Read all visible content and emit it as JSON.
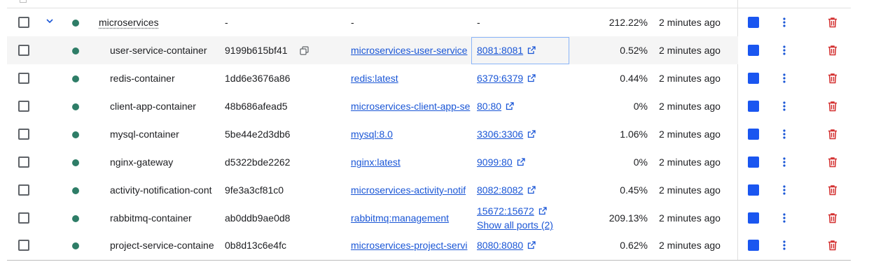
{
  "group": {
    "name": "microservices",
    "container_id": "-",
    "image": "-",
    "ports": "-",
    "cpu": "212.22%",
    "last_started": "2 minutes ago"
  },
  "containers": [
    {
      "name": "user-service-container",
      "container_id": "9199b615bf41",
      "image": "microservices-user-service",
      "port": "8081:8081",
      "port_extra": "",
      "cpu": "0.52%",
      "last_started": "2 minutes ago"
    },
    {
      "name": "redis-container",
      "container_id": "1dd6e3676a86",
      "image": "redis:latest",
      "port": "6379:6379",
      "port_extra": "",
      "cpu": "0.44%",
      "last_started": "2 minutes ago"
    },
    {
      "name": "client-app-container",
      "container_id": "48b686afead5",
      "image": "microservices-client-app-se",
      "port": "80:80",
      "port_extra": "",
      "cpu": "0%",
      "last_started": "2 minutes ago"
    },
    {
      "name": "mysql-container",
      "container_id": "5be44e2d3db6",
      "image": "mysql:8.0",
      "port": "3306:3306",
      "port_extra": "",
      "cpu": "1.06%",
      "last_started": "2 minutes ago"
    },
    {
      "name": "nginx-gateway",
      "container_id": "d5322bde2262",
      "image": "nginx:latest",
      "port": "9099:80",
      "port_extra": "",
      "cpu": "0%",
      "last_started": "2 minutes ago"
    },
    {
      "name": "activity-notification-cont",
      "container_id": "9fe3a3cf81c0",
      "image": "microservices-activity-notif",
      "port": "8082:8082",
      "port_extra": "",
      "cpu": "0.45%",
      "last_started": "2 minutes ago"
    },
    {
      "name": "rabbitmq-container",
      "container_id": "ab0ddb9ae0d8",
      "image": "rabbitmq:management",
      "port": "15672:15672",
      "port_extra": "Show all ports (2)",
      "cpu": "209.13%",
      "last_started": "2 minutes ago"
    },
    {
      "name": "project-service-containe",
      "container_id": "0b8d13c6e4fc",
      "image": "microservices-project-servi",
      "port": "8080:8080",
      "port_extra": "",
      "cpu": "0.62%",
      "last_started": "2 minutes ago"
    }
  ],
  "icons": {
    "status_running": "status-dot",
    "expand": "chevron-down-icon",
    "copy": "copy-icon",
    "external": "external-link-icon",
    "stop": "stop-icon",
    "more": "more-vert-icon",
    "delete": "trash-icon"
  },
  "colors": {
    "running_dot": "#2e7d67",
    "link": "#1a56d6",
    "stop_button": "#1a56f0",
    "delete_icon": "#d32f2f"
  }
}
